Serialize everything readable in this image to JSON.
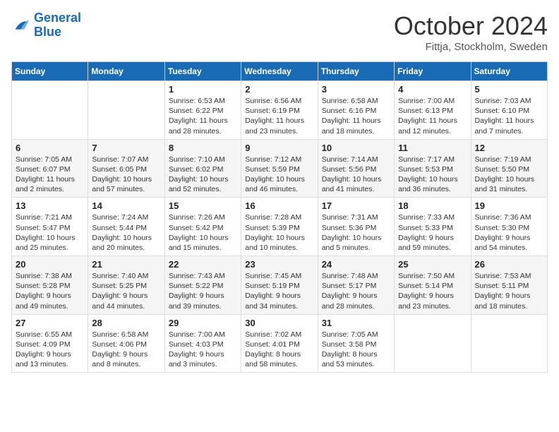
{
  "logo": {
    "line1": "General",
    "line2": "Blue"
  },
  "title": "October 2024",
  "location": "Fittja, Stockholm, Sweden",
  "days_of_week": [
    "Sunday",
    "Monday",
    "Tuesday",
    "Wednesday",
    "Thursday",
    "Friday",
    "Saturday"
  ],
  "weeks": [
    [
      {
        "day": "",
        "detail": ""
      },
      {
        "day": "",
        "detail": ""
      },
      {
        "day": "1",
        "detail": "Sunrise: 6:53 AM\nSunset: 6:22 PM\nDaylight: 11 hours\nand 28 minutes."
      },
      {
        "day": "2",
        "detail": "Sunrise: 6:56 AM\nSunset: 6:19 PM\nDaylight: 11 hours\nand 23 minutes."
      },
      {
        "day": "3",
        "detail": "Sunrise: 6:58 AM\nSunset: 6:16 PM\nDaylight: 11 hours\nand 18 minutes."
      },
      {
        "day": "4",
        "detail": "Sunrise: 7:00 AM\nSunset: 6:13 PM\nDaylight: 11 hours\nand 12 minutes."
      },
      {
        "day": "5",
        "detail": "Sunrise: 7:03 AM\nSunset: 6:10 PM\nDaylight: 11 hours\nand 7 minutes."
      }
    ],
    [
      {
        "day": "6",
        "detail": "Sunrise: 7:05 AM\nSunset: 6:07 PM\nDaylight: 11 hours\nand 2 minutes."
      },
      {
        "day": "7",
        "detail": "Sunrise: 7:07 AM\nSunset: 6:05 PM\nDaylight: 10 hours\nand 57 minutes."
      },
      {
        "day": "8",
        "detail": "Sunrise: 7:10 AM\nSunset: 6:02 PM\nDaylight: 10 hours\nand 52 minutes."
      },
      {
        "day": "9",
        "detail": "Sunrise: 7:12 AM\nSunset: 5:59 PM\nDaylight: 10 hours\nand 46 minutes."
      },
      {
        "day": "10",
        "detail": "Sunrise: 7:14 AM\nSunset: 5:56 PM\nDaylight: 10 hours\nand 41 minutes."
      },
      {
        "day": "11",
        "detail": "Sunrise: 7:17 AM\nSunset: 5:53 PM\nDaylight: 10 hours\nand 36 minutes."
      },
      {
        "day": "12",
        "detail": "Sunrise: 7:19 AM\nSunset: 5:50 PM\nDaylight: 10 hours\nand 31 minutes."
      }
    ],
    [
      {
        "day": "13",
        "detail": "Sunrise: 7:21 AM\nSunset: 5:47 PM\nDaylight: 10 hours\nand 25 minutes."
      },
      {
        "day": "14",
        "detail": "Sunrise: 7:24 AM\nSunset: 5:44 PM\nDaylight: 10 hours\nand 20 minutes."
      },
      {
        "day": "15",
        "detail": "Sunrise: 7:26 AM\nSunset: 5:42 PM\nDaylight: 10 hours\nand 15 minutes."
      },
      {
        "day": "16",
        "detail": "Sunrise: 7:28 AM\nSunset: 5:39 PM\nDaylight: 10 hours\nand 10 minutes."
      },
      {
        "day": "17",
        "detail": "Sunrise: 7:31 AM\nSunset: 5:36 PM\nDaylight: 10 hours\nand 5 minutes."
      },
      {
        "day": "18",
        "detail": "Sunrise: 7:33 AM\nSunset: 5:33 PM\nDaylight: 9 hours\nand 59 minutes."
      },
      {
        "day": "19",
        "detail": "Sunrise: 7:36 AM\nSunset: 5:30 PM\nDaylight: 9 hours\nand 54 minutes."
      }
    ],
    [
      {
        "day": "20",
        "detail": "Sunrise: 7:38 AM\nSunset: 5:28 PM\nDaylight: 9 hours\nand 49 minutes."
      },
      {
        "day": "21",
        "detail": "Sunrise: 7:40 AM\nSunset: 5:25 PM\nDaylight: 9 hours\nand 44 minutes."
      },
      {
        "day": "22",
        "detail": "Sunrise: 7:43 AM\nSunset: 5:22 PM\nDaylight: 9 hours\nand 39 minutes."
      },
      {
        "day": "23",
        "detail": "Sunrise: 7:45 AM\nSunset: 5:19 PM\nDaylight: 9 hours\nand 34 minutes."
      },
      {
        "day": "24",
        "detail": "Sunrise: 7:48 AM\nSunset: 5:17 PM\nDaylight: 9 hours\nand 28 minutes."
      },
      {
        "day": "25",
        "detail": "Sunrise: 7:50 AM\nSunset: 5:14 PM\nDaylight: 9 hours\nand 23 minutes."
      },
      {
        "day": "26",
        "detail": "Sunrise: 7:53 AM\nSunset: 5:11 PM\nDaylight: 9 hours\nand 18 minutes."
      }
    ],
    [
      {
        "day": "27",
        "detail": "Sunrise: 6:55 AM\nSunset: 4:09 PM\nDaylight: 9 hours\nand 13 minutes."
      },
      {
        "day": "28",
        "detail": "Sunrise: 6:58 AM\nSunset: 4:06 PM\nDaylight: 9 hours\nand 8 minutes."
      },
      {
        "day": "29",
        "detail": "Sunrise: 7:00 AM\nSunset: 4:03 PM\nDaylight: 9 hours\nand 3 minutes."
      },
      {
        "day": "30",
        "detail": "Sunrise: 7:02 AM\nSunset: 4:01 PM\nDaylight: 8 hours\nand 58 minutes."
      },
      {
        "day": "31",
        "detail": "Sunrise: 7:05 AM\nSunset: 3:58 PM\nDaylight: 8 hours\nand 53 minutes."
      },
      {
        "day": "",
        "detail": ""
      },
      {
        "day": "",
        "detail": ""
      }
    ]
  ]
}
